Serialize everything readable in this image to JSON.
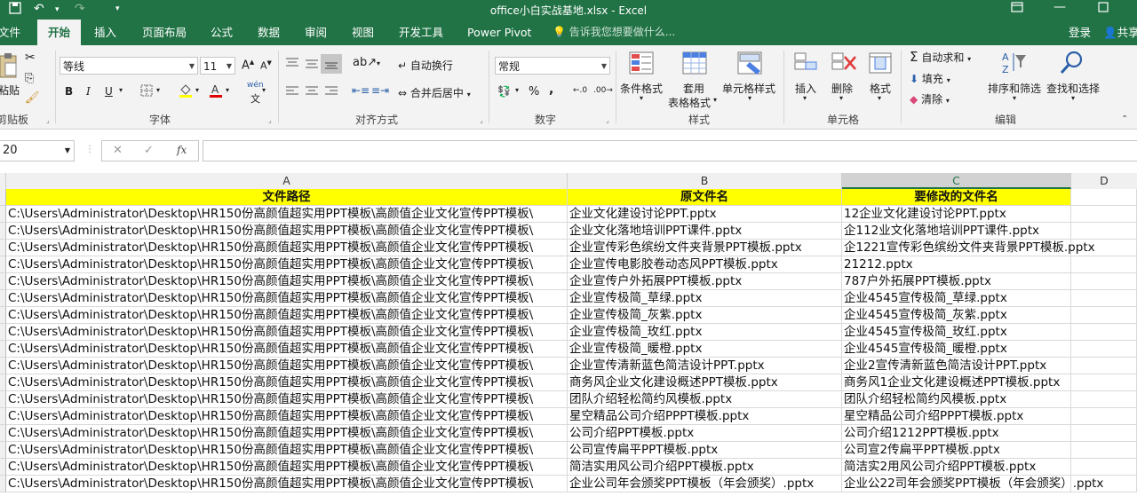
{
  "titlebar": {
    "title": "office小白实战基地.xlsx - Excel",
    "save_icon": "save-icon",
    "undo_icon": "undo-icon",
    "redo_icon": "redo-icon"
  },
  "tabs": [
    {
      "label": "文件"
    },
    {
      "label": "开始",
      "active": true
    },
    {
      "label": "插入"
    },
    {
      "label": "页面布局"
    },
    {
      "label": "公式"
    },
    {
      "label": "数据"
    },
    {
      "label": "审阅"
    },
    {
      "label": "视图"
    },
    {
      "label": "开发工具"
    },
    {
      "label": "Power Pivot"
    }
  ],
  "tell_me": "告诉我您想要做什么...",
  "account": {
    "login": "登录",
    "share": "共享"
  },
  "ribbon": {
    "clipboard": {
      "paste": "粘贴",
      "group": "剪贴板"
    },
    "font": {
      "name": "等线",
      "size": "11",
      "group": "字体",
      "bold": "B",
      "italic": "I",
      "underline": "U",
      "grow": "A",
      "shrink": "A",
      "wen": "wén"
    },
    "alignment": {
      "wrap": "自动换行",
      "merge": "合并后居中",
      "group": "对齐方式"
    },
    "number": {
      "format": "常规",
      "percent": "%",
      "comma": ",",
      "group": "数字"
    },
    "styles": {
      "conditional": "条件格式",
      "table_line1": "套用",
      "table_line2": "表格格式",
      "cell_styles": "单元格样式",
      "group": "样式"
    },
    "cells": {
      "insert": "插入",
      "delete": "删除",
      "format": "格式",
      "group": "单元格"
    },
    "editing": {
      "autosum": "自动求和",
      "fill": "填充",
      "clear": "清除",
      "sort": "排序和筛选",
      "find": "查找和选择",
      "group": "编辑"
    }
  },
  "formula_bar": {
    "name_box": "20",
    "cancel": "✕",
    "enter": "✓",
    "fx": "fx",
    "formula": ""
  },
  "columns": [
    "A",
    "B",
    "C",
    "D"
  ],
  "header_row": [
    "文件路径",
    "原文件名",
    "要修改的文件名"
  ],
  "rows": [
    [
      "C:\\Users\\Administrator\\Desktop\\HR150份高颜值超实用PPT模板\\高颜值企业文化宣传PPT模板\\",
      "企业文化建设讨论PPT.pptx",
      "12企业文化建设讨论PPT.pptx"
    ],
    [
      "C:\\Users\\Administrator\\Desktop\\HR150份高颜值超实用PPT模板\\高颜值企业文化宣传PPT模板\\",
      "企业文化落地培训PPT课件.pptx",
      "企112业文化落地培训PPT课件.pptx"
    ],
    [
      "C:\\Users\\Administrator\\Desktop\\HR150份高颜值超实用PPT模板\\高颜值企业文化宣传PPT模板\\",
      "企业宣传彩色缤纷文件夹背景PPT模板.pptx",
      "企1221宣传彩色缤纷文件夹背景PPT模板.pptx"
    ],
    [
      "C:\\Users\\Administrator\\Desktop\\HR150份高颜值超实用PPT模板\\高颜值企业文化宣传PPT模板\\",
      "企业宣传电影胶卷动态风PPT模板.pptx",
      "21212.pptx"
    ],
    [
      "C:\\Users\\Administrator\\Desktop\\HR150份高颜值超实用PPT模板\\高颜值企业文化宣传PPT模板\\",
      "企业宣传户外拓展PPT模板.pptx",
      "787户外拓展PPT模板.pptx"
    ],
    [
      "C:\\Users\\Administrator\\Desktop\\HR150份高颜值超实用PPT模板\\高颜值企业文化宣传PPT模板\\",
      "企业宣传极简_草绿.pptx",
      "企业4545宣传极简_草绿.pptx"
    ],
    [
      "C:\\Users\\Administrator\\Desktop\\HR150份高颜值超实用PPT模板\\高颜值企业文化宣传PPT模板\\",
      "企业宣传极简_灰紫.pptx",
      "企业4545宣传极简_灰紫.pptx"
    ],
    [
      "C:\\Users\\Administrator\\Desktop\\HR150份高颜值超实用PPT模板\\高颜值企业文化宣传PPT模板\\",
      "企业宣传极简_玫红.pptx",
      "企业4545宣传极简_玫红.pptx"
    ],
    [
      "C:\\Users\\Administrator\\Desktop\\HR150份高颜值超实用PPT模板\\高颜值企业文化宣传PPT模板\\",
      "企业宣传极简_暖橙.pptx",
      "企业4545宣传极简_暖橙.pptx"
    ],
    [
      "C:\\Users\\Administrator\\Desktop\\HR150份高颜值超实用PPT模板\\高颜值企业文化宣传PPT模板\\",
      "企业宣传清新蓝色简洁设计PPT.pptx",
      "企业2宣传清新蓝色简洁设计PPT.pptx"
    ],
    [
      "C:\\Users\\Administrator\\Desktop\\HR150份高颜值超实用PPT模板\\高颜值企业文化宣传PPT模板\\",
      "商务风企业文化建设概述PPT模板.pptx",
      "商务风1企业文化建设概述PPT模板.pptx"
    ],
    [
      "C:\\Users\\Administrator\\Desktop\\HR150份高颜值超实用PPT模板\\高颜值企业文化宣传PPT模板\\",
      "团队介绍轻松简约风模板.pptx",
      "团队介绍轻松简约风模板.pptx"
    ],
    [
      "C:\\Users\\Administrator\\Desktop\\HR150份高颜值超实用PPT模板\\高颜值企业文化宣传PPT模板\\",
      "星空精品公司介绍PPPT模板.pptx",
      "星空精品公司介绍PPPT模板.pptx"
    ],
    [
      "C:\\Users\\Administrator\\Desktop\\HR150份高颜值超实用PPT模板\\高颜值企业文化宣传PPT模板\\",
      "公司介绍PPT模板.pptx",
      "公司介绍1212PPT模板.pptx"
    ],
    [
      "C:\\Users\\Administrator\\Desktop\\HR150份高颜值超实用PPT模板\\高颜值企业文化宣传PPT模板\\",
      "公司宣传扁平PPT模板.pptx",
      "公司宣2传扁平PPT模板.pptx"
    ],
    [
      "C:\\Users\\Administrator\\Desktop\\HR150份高颜值超实用PPT模板\\高颜值企业文化宣传PPT模板\\",
      "简洁实用风公司介绍PPT模板.pptx",
      "简洁实2用风公司介绍PPT模板.pptx"
    ],
    [
      "C:\\Users\\Administrator\\Desktop\\HR150份高颜值超实用PPT模板\\高颜值企业文化宣传PPT模板\\",
      "企业公司年会颁奖PPT模板（年会颁奖）.pptx",
      "企业公22司年会颁奖PPT模板（年会颁奖）.pptx"
    ]
  ]
}
